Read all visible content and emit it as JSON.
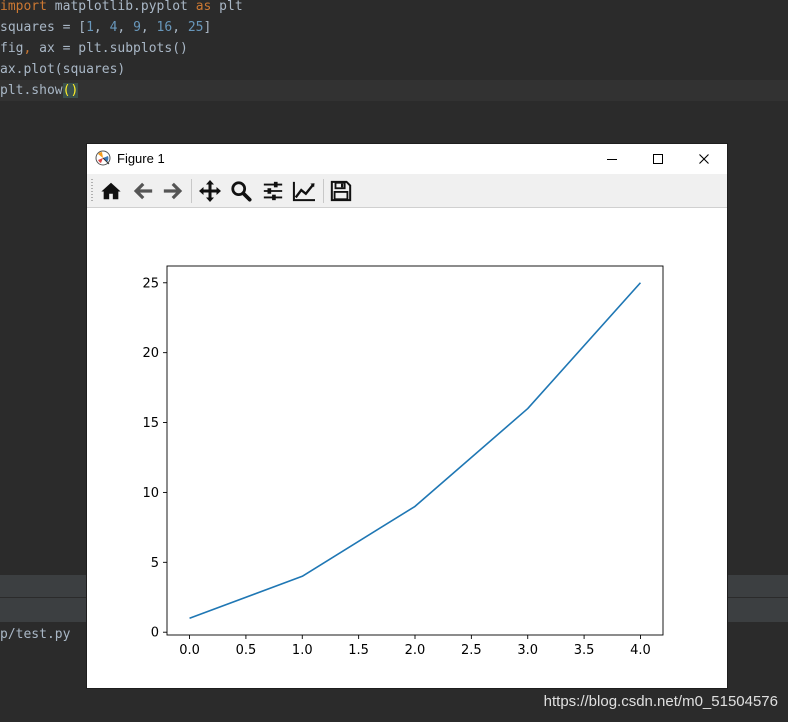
{
  "editor": {
    "lines": [
      {
        "parts": [
          {
            "t": "import",
            "c": "kw"
          },
          {
            "t": " matplotlib.pyplot "
          },
          {
            "t": "as",
            "c": "kw"
          },
          {
            "t": " plt"
          }
        ]
      },
      {
        "parts": [
          {
            "t": "squares = ["
          },
          {
            "t": "1",
            "c": "num"
          },
          {
            "t": ", "
          },
          {
            "t": "4",
            "c": "num"
          },
          {
            "t": ", "
          },
          {
            "t": "9",
            "c": "num"
          },
          {
            "t": ", "
          },
          {
            "t": "16",
            "c": "num"
          },
          {
            "t": ", "
          },
          {
            "t": "25",
            "c": "num"
          },
          {
            "t": "]"
          }
        ]
      },
      {
        "parts": [
          {
            "t": "fig"
          },
          {
            "t": ",",
            "c": "kw"
          },
          {
            "t": " ax = plt.subplots()"
          }
        ]
      },
      {
        "parts": [
          {
            "t": "ax.plot(squares)"
          }
        ]
      },
      {
        "parts": [
          {
            "t": "plt.show"
          },
          {
            "t": "()",
            "c": "paren-hl"
          }
        ]
      }
    ],
    "run_path": "p/test.py"
  },
  "window": {
    "title": "Figure 1",
    "minimize_label": "–",
    "maximize_label": "□",
    "close_label": "×"
  },
  "toolbar": {
    "tools": [
      "home-icon",
      "back-icon",
      "forward-icon",
      "pan-icon",
      "zoom-icon",
      "configure-subplots-icon",
      "edit-axis-icon",
      "save-icon"
    ]
  },
  "watermark": "https://blog.csdn.net/m0_51504576",
  "colors": {
    "line": "#1f77b4",
    "editor_bg": "#2b2b2b"
  },
  "chart_data": {
    "type": "line",
    "x": [
      0,
      1,
      2,
      3,
      4
    ],
    "series": [
      {
        "values": [
          1,
          4,
          9,
          16,
          25
        ]
      }
    ],
    "xlim": [
      -0.2,
      4.2
    ],
    "ylim": [
      -0.2,
      26.2
    ],
    "xticks": [
      "0.0",
      "0.5",
      "1.0",
      "1.5",
      "2.0",
      "2.5",
      "3.0",
      "3.5",
      "4.0"
    ],
    "xtick_values": [
      0,
      0.5,
      1,
      1.5,
      2,
      2.5,
      3,
      3.5,
      4
    ],
    "yticks": [
      "0",
      "5",
      "10",
      "15",
      "20",
      "25"
    ],
    "ytick_values": [
      0,
      5,
      10,
      15,
      20,
      25
    ],
    "title": "",
    "xlabel": "",
    "ylabel": "",
    "grid": false
  }
}
